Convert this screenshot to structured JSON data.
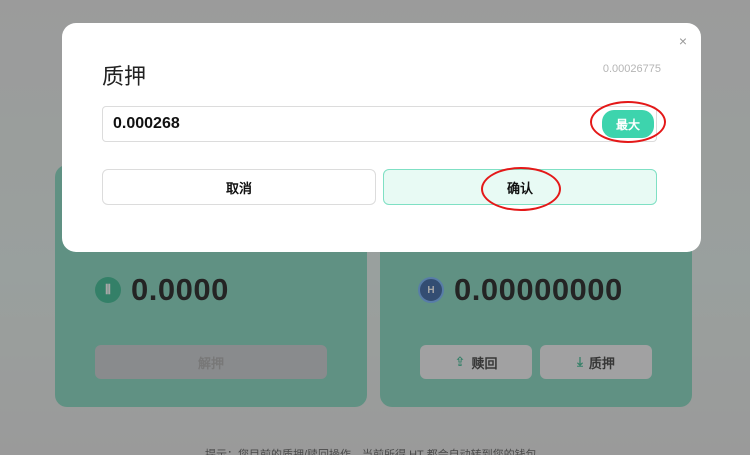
{
  "background": {
    "left_card": {
      "amount": "0.0000",
      "coin_icon": "token-logo-icon",
      "disabled_button_label": "解押"
    },
    "right_card": {
      "amount": "0.00000000",
      "coin_icon": "hbtc-logo-icon",
      "redeem_label": "赎回",
      "stake_label": "质押"
    },
    "hint_text": "提示：您目前的质押/赎回操作，当前所得 HT 都会自动转到您的钱包"
  },
  "modal": {
    "title": "质押",
    "balance": "0.00026775",
    "input": {
      "value": "0.000268",
      "placeholder": ""
    },
    "max_label": "最大",
    "cancel_label": "取消",
    "confirm_label": "确认"
  },
  "colors": {
    "accent": "#3dd4ad",
    "annotation": "#e41818"
  }
}
